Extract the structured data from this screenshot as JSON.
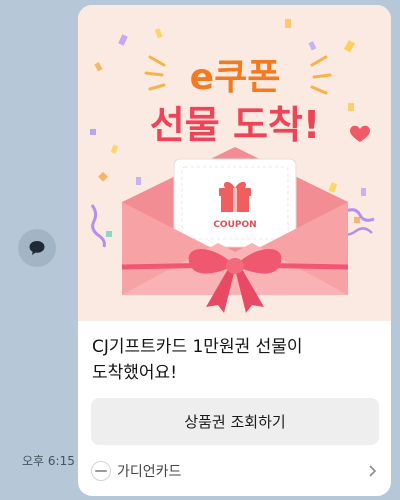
{
  "banner": {
    "headline_line1": "e쿠폰",
    "headline_line2": "선물 도착!",
    "coupon_label": "COUPON"
  },
  "message": {
    "line1": "CJ기프트카드 1만원권 선물이",
    "line2": "도착했어요!"
  },
  "action_button_label": "상품권 조회하기",
  "channel": {
    "name": "가디언카드",
    "icon": "channel-logo"
  },
  "timestamp": "오후 6:15",
  "colors": {
    "chat_background": "#b6c8d8",
    "banner_background": "#fbeae2",
    "headline_orange": "#f47a1f",
    "headline_red": "#ee4457",
    "envelope_pink": "#f7a3a6",
    "ribbon": "#f0586f"
  }
}
